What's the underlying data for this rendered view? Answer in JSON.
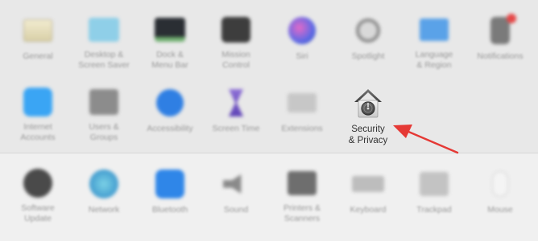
{
  "row1": [
    {
      "label": "General",
      "icon": "general-icon"
    },
    {
      "label": "Desktop &\nScreen Saver",
      "icon": "desktop-icon"
    },
    {
      "label": "Dock &\nMenu Bar",
      "icon": "dock-icon"
    },
    {
      "label": "Mission\nControl",
      "icon": "mission-control-icon"
    },
    {
      "label": "Siri",
      "icon": "siri-icon"
    },
    {
      "label": "Spotlight",
      "icon": "spotlight-icon"
    },
    {
      "label": "Language\n& Region",
      "icon": "flag-icon"
    },
    {
      "label": "Notifications",
      "icon": "notifications-icon"
    }
  ],
  "row2": [
    {
      "label": "Internet\nAccounts",
      "icon": "at-icon"
    },
    {
      "label": "Users &\nGroups",
      "icon": "users-icon"
    },
    {
      "label": "Accessibility",
      "icon": "accessibility-icon"
    },
    {
      "label": "Screen Time",
      "icon": "hourglass-icon"
    },
    {
      "label": "Extensions",
      "icon": "puzzle-icon"
    },
    {
      "label": "Security\n& Privacy",
      "icon": "house-lock-icon"
    }
  ],
  "row3": [
    {
      "label": "Software\nUpdate",
      "icon": "gear-icon"
    },
    {
      "label": "Network",
      "icon": "globe-icon"
    },
    {
      "label": "Bluetooth",
      "icon": "bluetooth-icon"
    },
    {
      "label": "Sound",
      "icon": "speaker-icon"
    },
    {
      "label": "Printers &\nScanners",
      "icon": "printer-icon"
    },
    {
      "label": "Keyboard",
      "icon": "keyboard-icon"
    },
    {
      "label": "Trackpad",
      "icon": "trackpad-icon"
    },
    {
      "label": "Mouse",
      "icon": "mouse-icon"
    }
  ],
  "annotation": {
    "arrow_color": "#e53935"
  }
}
